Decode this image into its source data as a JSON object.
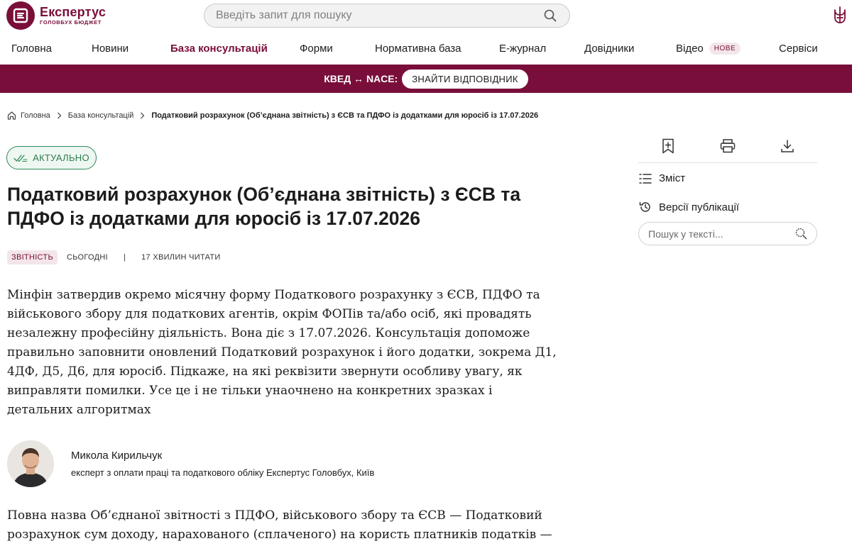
{
  "header": {
    "logo_name": "Експертус",
    "logo_subtitle": "ГОЛОВБУХ БЮДЖЕТ",
    "search_placeholder": "Введіть запит для пошуку"
  },
  "nav": {
    "items": [
      {
        "label": "Головна"
      },
      {
        "label": "Новини"
      },
      {
        "label": "База консультацій",
        "active": true
      },
      {
        "label": "Форми"
      },
      {
        "label": "Нормативна база"
      },
      {
        "label": "Е-журнал"
      },
      {
        "label": "Довідники"
      },
      {
        "label": "Відео",
        "badge": "НОВЕ"
      },
      {
        "label": "Сервіси"
      }
    ]
  },
  "banner": {
    "text": "КВЕД ↔ NACE:",
    "button": "ЗНАЙТИ ВІДПОВІДНИК"
  },
  "breadcrumb": {
    "home": "Головна",
    "section": "База консультацій",
    "current": "Податковий розрахунок (Об’єднана звітність) з ЄСВ та ПДФО із додатками для юросіб із 17.07.2026"
  },
  "article": {
    "status": "АКТУАЛЬНО",
    "title": "Податковий розрахунок (Об’єднана звітність) з ЄСВ та ПДФО із додатками для юросіб із 17.07.2026",
    "tag": "ЗВІТНІСТЬ",
    "date": "СЬОГОДНІ",
    "separator": "|",
    "read_time": "17 ХВИЛИН ЧИТАТИ",
    "lead": "Мінфін затвердив окремо місячну форму Податкового розрахунку з ЄСВ, ПДФО та військового збору для податкових агентів, окрім ФОПів та/або осіб, які провадять незалежну професійну діяльність. Вона діє з 17.07.2026. Консультація допоможе правильно заповнити оновлений Податковий розрахунок і його додатки, зокрема Д1, 4ДФ, Д5, Д6, для юросіб. Підкаже, на які реквізити звернути особливу увагу, як виправляти помилки. Усе це і не тільки унаочнено на конкретних зразках і детальних алгоритмах",
    "author_name": "Микола Кирильчук",
    "author_role": "експерт з оплати праці та податкового обліку Експертус Головбух, Київ",
    "body": "Повна назва Об’єднаної звітності з ПДФО, військового збору та ЄСВ — Податковий розрахунок сум доходу, нарахованого (сплаченого) на користь платників податків — фізичних осіб, і сум"
  },
  "sidebar": {
    "contents": "Зміст",
    "versions": "Версії публікації",
    "search_placeholder": "Пошук у тексті..."
  },
  "colors": {
    "brand": "#7a0e3a",
    "status_green": "#2e8b57"
  }
}
